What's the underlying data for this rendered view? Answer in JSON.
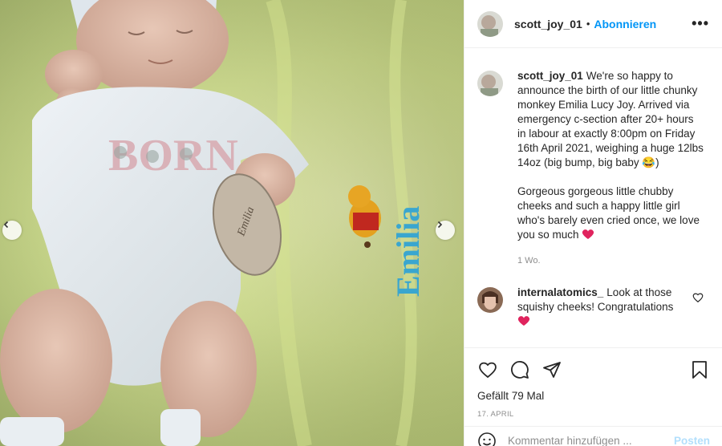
{
  "post": {
    "username": "scott_joy_01",
    "separator": "•",
    "follow_label": "Abonnieren",
    "more_label": "•••"
  },
  "media": {
    "onesie_text": "BORN",
    "blanket_text": "Emilia",
    "plaque_text": "Emilia"
  },
  "caption": {
    "username": "scott_joy_01",
    "text_part1": "We're so happy to announce the birth of our little chunky monkey Emilia Lucy Joy. Arrived via emergency c-section after 20+ hours in labour at exactly 8:00pm on Friday 16th April 2021, weighing a huge 12lbs 14oz (big bump, big baby 😂)",
    "text_part2": "Gorgeous gorgeous little chubby cheeks and such a happy little girl who's barely even cried once, we love you so much",
    "age": "1 Wo."
  },
  "comments": [
    {
      "username": "internalatomics_",
      "text": "Look at those squishy cheeks! Congratulations"
    }
  ],
  "actions": {
    "likes": "Gefällt 79 Mal",
    "date": "17. APRIL"
  },
  "add_comment": {
    "placeholder": "Kommentar hinzufügen ...",
    "post_label": "Posten"
  },
  "icons": [
    "chevron-left-icon",
    "chevron-right-icon",
    "heart-icon",
    "comment-icon",
    "share-icon",
    "bookmark-icon",
    "emoji-icon",
    "more-icon"
  ],
  "colors": {
    "link_blue": "#0095f6",
    "post_disabled": "#b2dffc",
    "heart_red": "#e0245e",
    "muted": "#8e8e8e"
  }
}
